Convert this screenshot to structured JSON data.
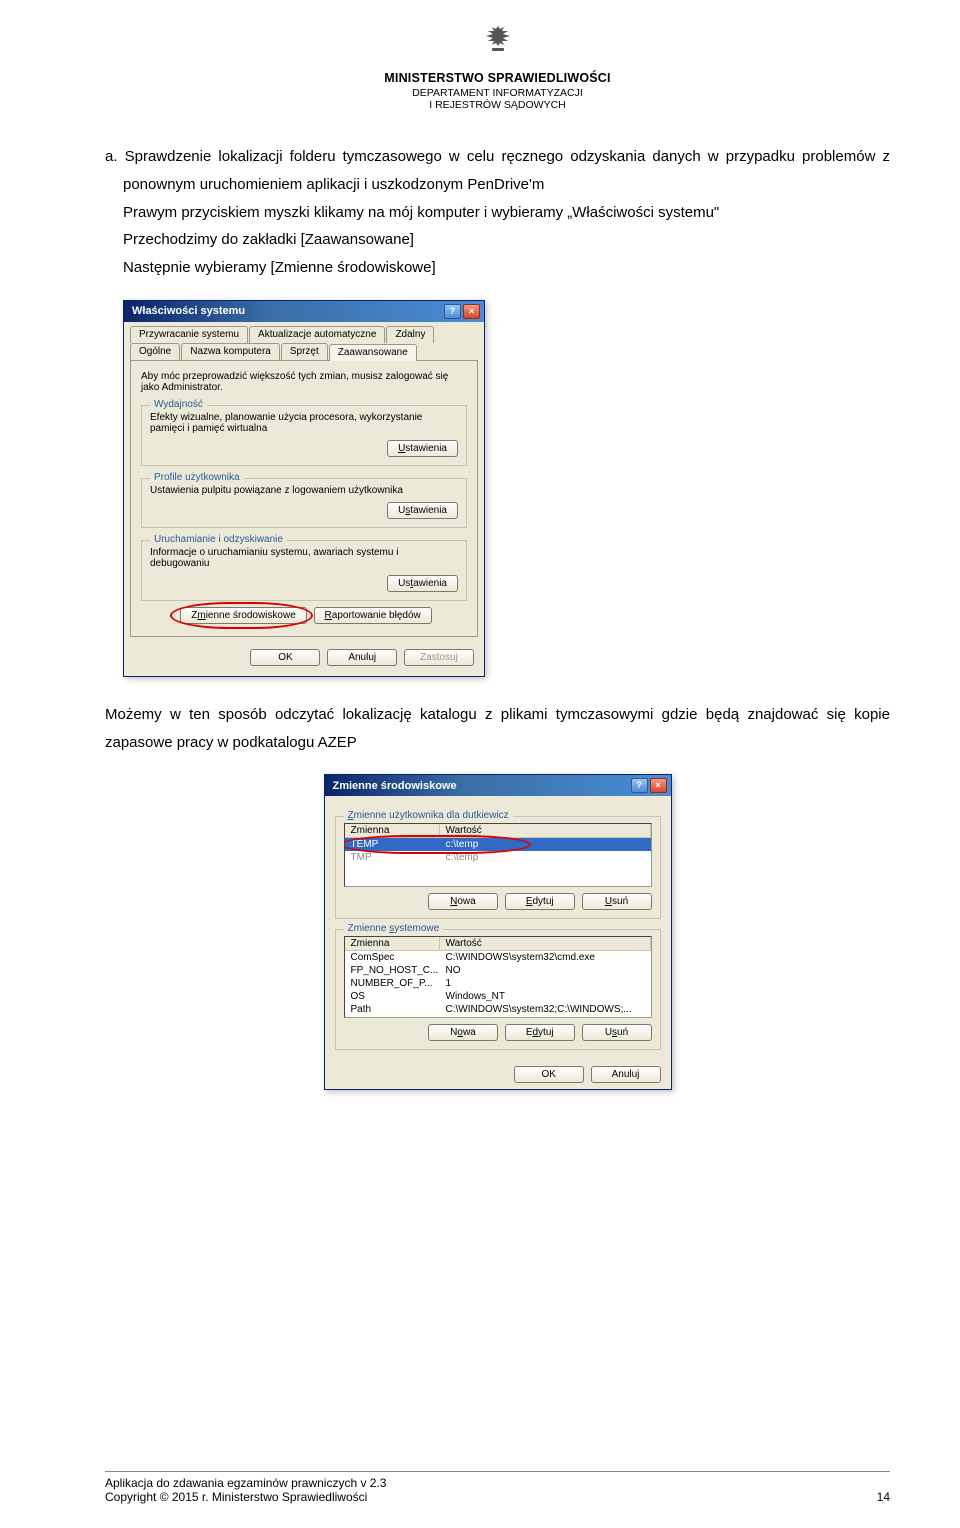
{
  "header": {
    "ministry": "MINISTERSTWO SPRAWIEDLIWOŚCI",
    "dept1": "DEPARTAMENT INFORMATYZACJI",
    "dept2": "I REJESTRÓW SĄDOWYCH"
  },
  "content": {
    "item_a": "a. Sprawdzenie lokalizacji folderu tymczasowego w celu ręcznego odzyskania danych w przypadku problemów z ponownym uruchomieniem aplikacji i uszkodzonym PenDrive'm",
    "line1": "Prawym przyciskiem myszki klikamy na mój komputer i wybieramy „Właściwości systemu\"",
    "line2": "Przechodzimy do zakładki [Zaawansowane]",
    "line3": "Następnie wybieramy [Zmienne środowiskowe]",
    "after_screenshot": "Możemy w ten sposób odczytać lokalizację katalogu z plikami tymczasowymi gdzie będą znajdować się kopie zapasowe pracy w podkatalogu AZEP"
  },
  "sysdlg": {
    "title": "Właściwości systemu",
    "tabs_top": [
      "Przywracanie systemu",
      "Aktualizacje automatyczne",
      "Zdalny"
    ],
    "tabs_bottom": [
      "Ogólne",
      "Nazwa komputera",
      "Sprzęt",
      "Zaawansowane"
    ],
    "admin_note": "Aby móc przeprowadzić większość tych zmian, musisz zalogować się jako Administrator.",
    "perf": {
      "legend": "Wydajność",
      "desc": "Efekty wizualne, planowanie użycia procesora, wykorzystanie pamięci i pamięć wirtualna",
      "btn": "Ustawienia"
    },
    "profiles": {
      "legend": "Profile użytkownika",
      "desc": "Ustawienia pulpitu powiązane z logowaniem użytkownika",
      "btn": "Ustawienia"
    },
    "boot": {
      "legend": "Uruchamianie i odzyskiwanie",
      "desc": "Informacje o uruchamianiu systemu, awariach systemu i debugowaniu",
      "btn": "Ustawienia"
    },
    "env_btn": "Zmienne środowiskowe",
    "report_btn": "Raportowanie błędów",
    "ok": "OK",
    "cancel": "Anuluj",
    "apply": "Zastosuj"
  },
  "envdlg": {
    "title": "Zmienne środowiskowe",
    "user_legend": "Zmienne użytkownika dla dutkiewicz",
    "user_cols": [
      "Zmienna",
      "Wartość"
    ],
    "user_rows": [
      {
        "name": "TEMP",
        "value": "c:\\temp",
        "selected": true
      },
      {
        "name": "TMP",
        "value": "c:\\temp",
        "selected": false
      }
    ],
    "sys_legend": "Zmienne systemowe",
    "sys_cols": [
      "Zmienna",
      "Wartość"
    ],
    "sys_rows": [
      {
        "name": "ComSpec",
        "value": "C:\\WINDOWS\\system32\\cmd.exe"
      },
      {
        "name": "FP_NO_HOST_C...",
        "value": "NO"
      },
      {
        "name": "NUMBER_OF_P...",
        "value": "1"
      },
      {
        "name": "OS",
        "value": "Windows_NT"
      },
      {
        "name": "Path",
        "value": "C:\\WINDOWS\\system32;C:\\WINDOWS;..."
      }
    ],
    "new": "Nowa",
    "edit": "Edytuj",
    "del": "Usuń",
    "ok": "OK",
    "cancel": "Anuluj"
  },
  "footer": {
    "line1": "Aplikacja do zdawania egzaminów prawniczych v 2.3",
    "line2": "Copyright © 2015 r. Ministerstwo Sprawiedliwości",
    "page": "14"
  }
}
